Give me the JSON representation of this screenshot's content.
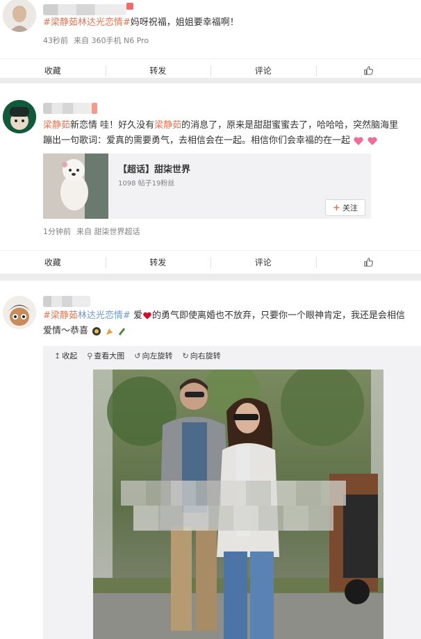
{
  "posts": [
    {
      "text_topic": "#梁静茹林达光恋情#",
      "text_body": "妈呀祝福，姐姐要幸福啊！",
      "time": "43秒前",
      "source": "来自 360手机 N6 Pro"
    },
    {
      "text_topic": "梁静茹",
      "text_part1": "新恋情 哇！好久没有",
      "text_topic2": "梁静茹",
      "text_part2": "的消息了，原来是甜甜蜜蜜去了，哈哈哈，突然脑海里蹦出一句歌词：爱真的需要勇气，去相信会在一起。相信你们会幸福的在一起",
      "chip_title": "【超话】甜柒世界",
      "chip_sub": "1098 帖子19粉丝",
      "follow_label": "关注",
      "time": "1分钟前",
      "source": "来自 甜柒世界超话"
    },
    {
      "text_topic_a": "#梁静茹",
      "text_topic_b": "林达光恋情#",
      "text_part1": " 爱",
      "text_part2": "的勇气即使离婚也不放弃，只要你一个眼神肯定，我还是会相信爱情～恭喜",
      "tools": [
        "收起",
        "查看大图",
        "向左旋转",
        "向右旋转"
      ]
    }
  ],
  "actions": {
    "collect": "收藏",
    "forward": "转发",
    "comment": "评论"
  },
  "colors": {
    "topic": "#eb7350",
    "topic_blue": "#6b9bd2",
    "meta": "#808080"
  }
}
